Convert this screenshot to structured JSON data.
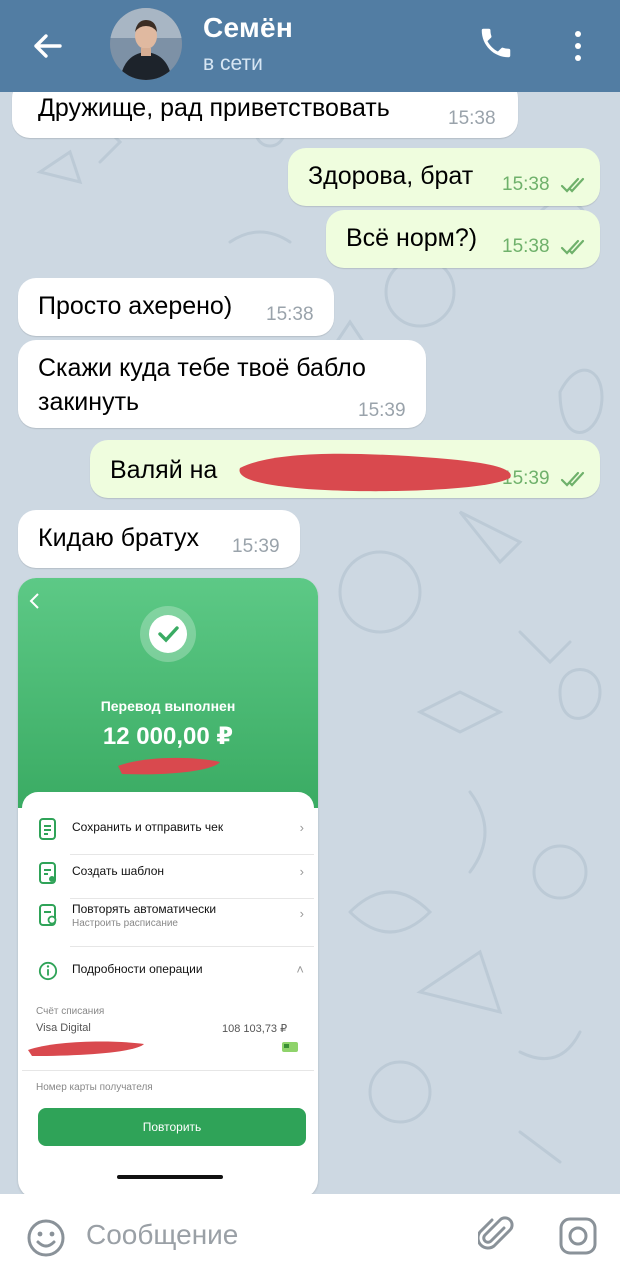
{
  "header": {
    "contact_name": "Семён",
    "status": "в сети"
  },
  "messages": [
    {
      "dir": "in",
      "text": "Дружище, рад приветствовать",
      "time": "15:38"
    },
    {
      "dir": "out",
      "text": "Здорова, брат",
      "time": "15:38",
      "read": true
    },
    {
      "dir": "out",
      "text": "Всё норм?)",
      "time": "15:38",
      "read": true
    },
    {
      "dir": "in",
      "text": "Просто ахерено)",
      "time": "15:38"
    },
    {
      "dir": "in",
      "text": "Скажи куда тебе твоё бабло закинуть",
      "line1": "Скажи куда тебе твоё бабло",
      "line2": "закинуть",
      "time": "15:39"
    },
    {
      "dir": "out",
      "text": "Валяй на",
      "time": "15:39",
      "read": true,
      "redacted": true
    },
    {
      "dir": "in",
      "text": "Кидаю братух",
      "time": "15:39"
    }
  ],
  "photo": {
    "title": "Перевод выполнен",
    "amount": "12 000,00 ₽",
    "rows": [
      {
        "label": "Сохранить и отправить чек"
      },
      {
        "label": "Создать шаблон"
      },
      {
        "label": "Повторять автоматически",
        "sublabel": "Настроить расписание"
      },
      {
        "label": "Подробности операции"
      }
    ],
    "account_label": "Счёт списания",
    "account_name": "Visa Digital",
    "account_balance": "108 103,73 ₽",
    "recipient_label": "Номер карты получателя",
    "repeat_button": "Повторить"
  },
  "input": {
    "placeholder": "Сообщение"
  },
  "colors": {
    "header": "#527da3",
    "incoming_bubble": "#ffffff",
    "outgoing_bubble": "#effdde",
    "outgoing_time": "#6fb16b",
    "redaction": "#d9494e",
    "bank_green": "#3aab63"
  }
}
